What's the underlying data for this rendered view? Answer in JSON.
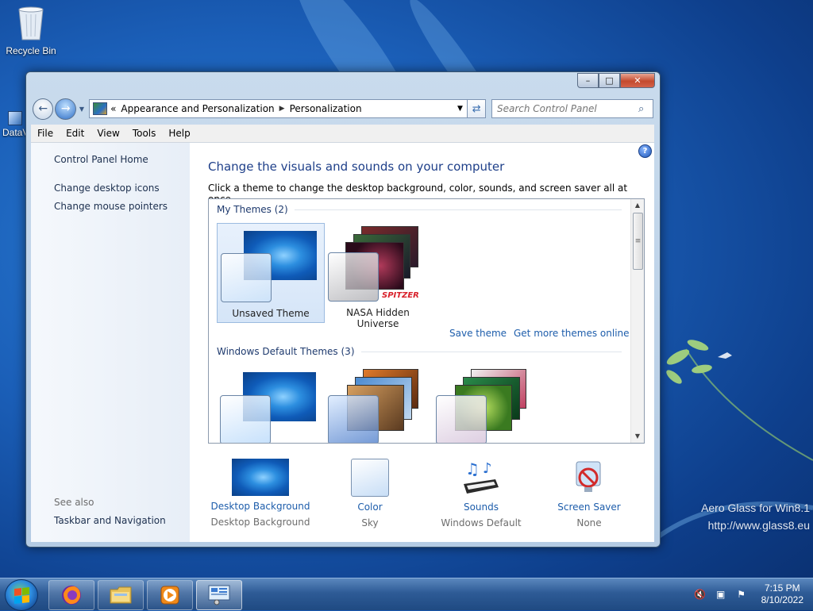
{
  "desktop": {
    "recycle_bin_label": "Recycle Bin",
    "partial_icon_label": "DataV",
    "watermark_line1": "Aero Glass for Win8.1",
    "watermark_line2": "http://www.glass8.eu"
  },
  "window": {
    "controls": {
      "minimize": "–",
      "maximize": "□",
      "close": "✕"
    }
  },
  "address_bar": {
    "overflow": "«",
    "crumbs": [
      "Appearance and Personalization",
      "Personalization"
    ],
    "separator": "▶"
  },
  "search": {
    "placeholder": "Search Control Panel"
  },
  "menu": [
    "File",
    "Edit",
    "View",
    "Tools",
    "Help"
  ],
  "sidebar": {
    "links": [
      "Control Panel Home",
      "Change desktop icons",
      "Change mouse pointers"
    ],
    "see_also_label": "See also",
    "see_also_links": [
      "Taskbar and Navigation"
    ]
  },
  "main": {
    "title": "Change the visuals and sounds on your computer",
    "subtitle": "Click a theme to change the desktop background, color, sounds, and screen saver all at once.",
    "my_themes_label": "My Themes (2)",
    "my_themes": [
      {
        "name": "Unsaved Theme",
        "selected": true
      },
      {
        "name": "NASA Hidden Universe",
        "selected": false,
        "brand": "SPITZER"
      }
    ],
    "save_theme_link": "Save theme",
    "more_themes_link": "Get more themes online",
    "default_themes_label": "Windows Default Themes (3)"
  },
  "bottom": [
    {
      "link": "Desktop Background",
      "value": "Desktop Background"
    },
    {
      "link": "Color",
      "value": "Sky"
    },
    {
      "link": "Sounds",
      "value": "Windows Default"
    },
    {
      "link": "Screen Saver",
      "value": "None"
    }
  ],
  "taskbar": {
    "time": "7:15 PM",
    "date": "8/10/2022"
  },
  "colors": {
    "link": "#1d5dab",
    "title": "#1e3f89",
    "close_button": "#c44a2e"
  }
}
